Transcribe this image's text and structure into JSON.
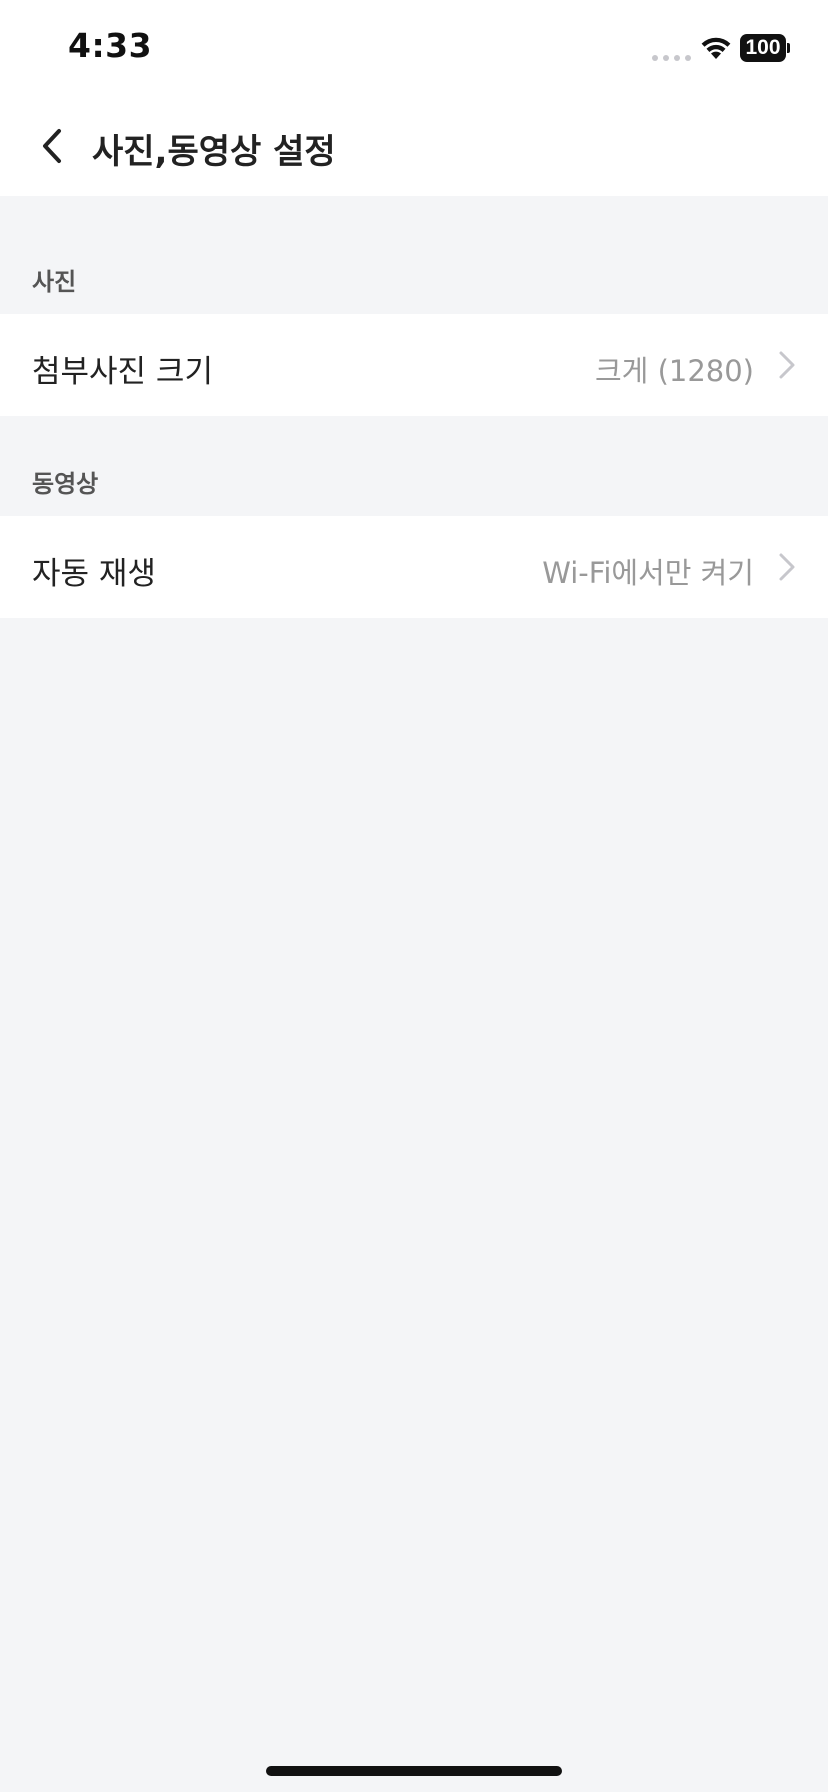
{
  "status_bar": {
    "time": "4:33",
    "battery": "100"
  },
  "nav": {
    "title": "사진,동영상 설정"
  },
  "sections": [
    {
      "label": "사진",
      "rows": [
        {
          "label": "첨부사진 크기",
          "value": "크게 (1280)"
        }
      ]
    },
    {
      "label": "동영상",
      "rows": [
        {
          "label": "자동 재생",
          "value": "Wi-Fi에서만 켜기"
        }
      ]
    }
  ],
  "colors": {
    "background": "#f4f5f7",
    "surface": "#ffffff",
    "text_primary": "#222222",
    "text_secondary": "#999999",
    "chevron": "#c7c7cc"
  },
  "icons": {
    "back": "chevron-left-icon",
    "row_arrow": "chevron-right-icon",
    "wifi": "wifi-icon",
    "battery": "battery-icon",
    "signal": "signal-dots-icon"
  }
}
